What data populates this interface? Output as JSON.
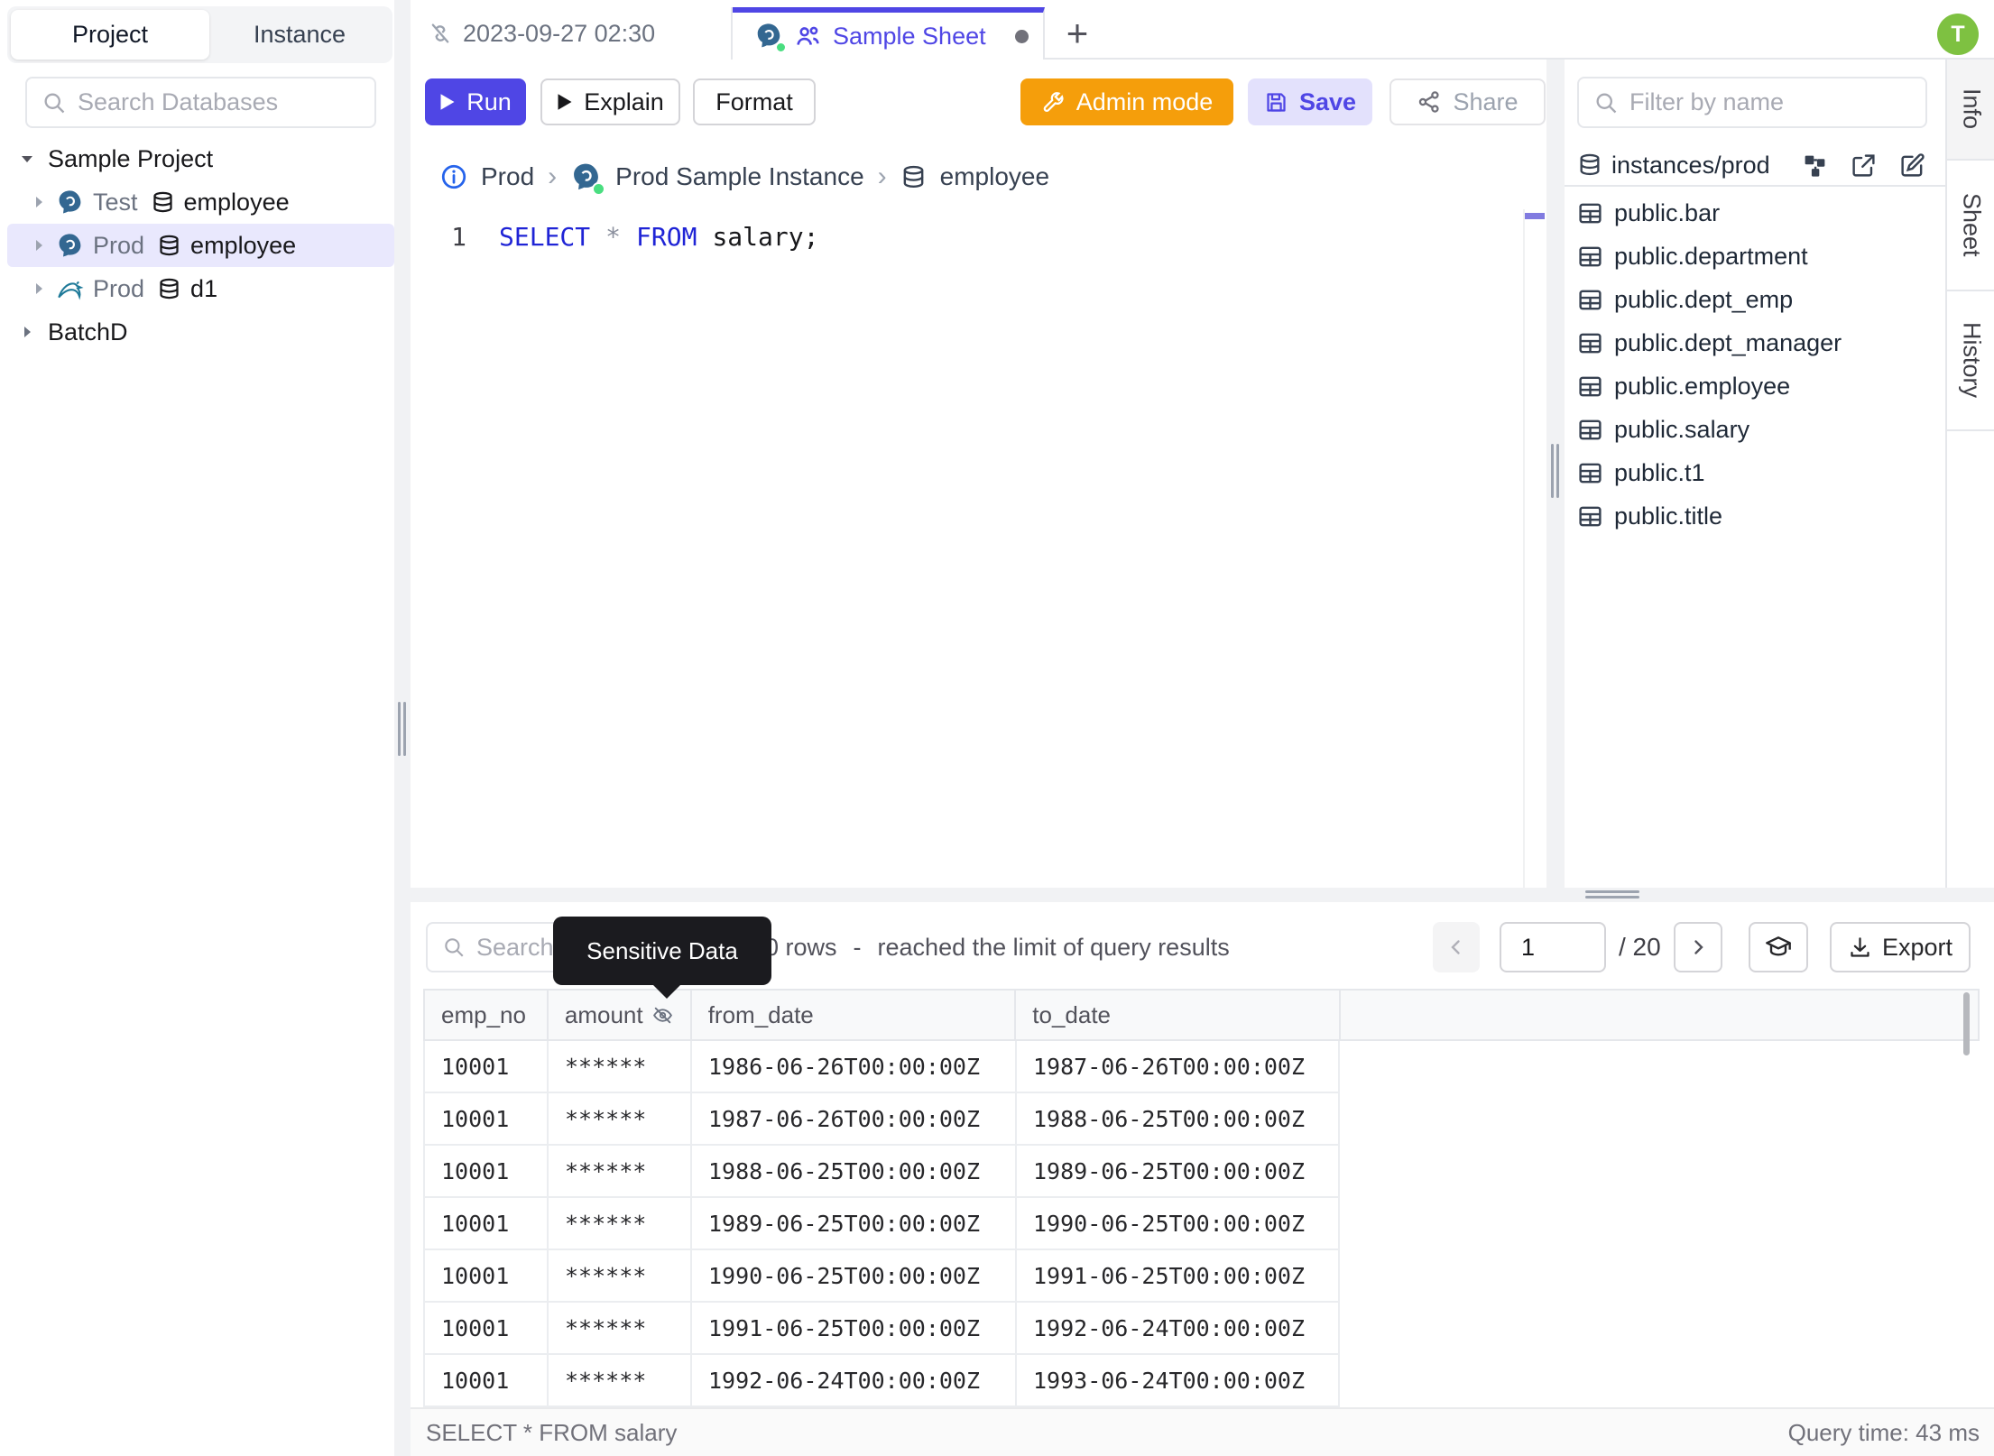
{
  "app": {
    "avatar_initial": "T"
  },
  "sidebar": {
    "tabs": {
      "project": "Project",
      "instance": "Instance"
    },
    "search_placeholder": "Search Databases",
    "tree": {
      "project1": "Sample Project",
      "item1": {
        "env": "Test",
        "db": "employee"
      },
      "item2": {
        "env": "Prod",
        "db": "employee"
      },
      "item3": {
        "env": "Prod",
        "db": "d1"
      },
      "project2": "BatchD"
    }
  },
  "tabbar": {
    "tab1": "2023-09-27 02:30",
    "tab2": "Sample Sheet",
    "new_tab": "+"
  },
  "toolbar": {
    "run": "Run",
    "explain": "Explain",
    "format": "Format",
    "admin_mode": "Admin mode",
    "save": "Save",
    "share": "Share"
  },
  "breadcrumb": {
    "env": "Prod",
    "instance": "Prod Sample Instance",
    "database": "employee"
  },
  "editor": {
    "line_number": "1",
    "tokens": {
      "select": "SELECT",
      "star": "*",
      "from": "FROM",
      "rest": "salary;"
    }
  },
  "schema_panel": {
    "filter_placeholder": "Filter by name",
    "title": "instances/prod",
    "tables": [
      "public.bar",
      "public.department",
      "public.dept_emp",
      "public.dept_manager",
      "public.employee",
      "public.salary",
      "public.t1",
      "public.title"
    ]
  },
  "side_tabs": {
    "info": "Info",
    "sheet": "Sheet",
    "history": "History"
  },
  "results": {
    "search_placeholder": "Search",
    "tooltip": "Sensitive Data",
    "row_count": "0 rows",
    "separator": "-",
    "limit_note": "reached the limit of query results",
    "page_value": "1",
    "page_total": "/ 20",
    "export_label": "Export",
    "columns": [
      "emp_no",
      "amount",
      "from_date",
      "to_date"
    ],
    "rows": [
      {
        "emp_no": "10001",
        "amount": "******",
        "from_date": "1986-06-26T00:00:00Z",
        "to_date": "1987-06-26T00:00:00Z"
      },
      {
        "emp_no": "10001",
        "amount": "******",
        "from_date": "1987-06-26T00:00:00Z",
        "to_date": "1988-06-25T00:00:00Z"
      },
      {
        "emp_no": "10001",
        "amount": "******",
        "from_date": "1988-06-25T00:00:00Z",
        "to_date": "1989-06-25T00:00:00Z"
      },
      {
        "emp_no": "10001",
        "amount": "******",
        "from_date": "1989-06-25T00:00:00Z",
        "to_date": "1990-06-25T00:00:00Z"
      },
      {
        "emp_no": "10001",
        "amount": "******",
        "from_date": "1990-06-25T00:00:00Z",
        "to_date": "1991-06-25T00:00:00Z"
      },
      {
        "emp_no": "10001",
        "amount": "******",
        "from_date": "1991-06-25T00:00:00Z",
        "to_date": "1992-06-24T00:00:00Z"
      },
      {
        "emp_no": "10001",
        "amount": "******",
        "from_date": "1992-06-24T00:00:00Z",
        "to_date": "1993-06-24T00:00:00Z"
      }
    ],
    "status_query": "SELECT * FROM salary",
    "status_time": "Query time: 43 ms"
  },
  "colors": {
    "accent": "#4f46e5",
    "admin_orange": "#f59e0b",
    "avatar_green": "#7ec141",
    "keyword_blue": "#1f24d6"
  }
}
